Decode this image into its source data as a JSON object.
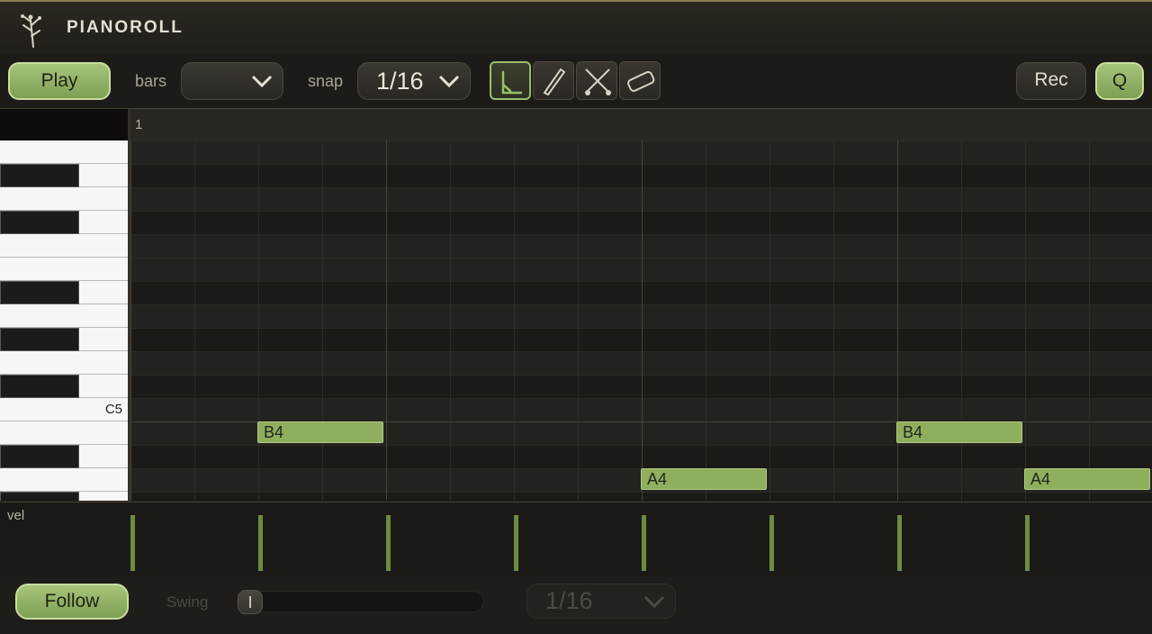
{
  "header": {
    "title": "PIANOROLL",
    "logo_icon": "branch-logo-icon"
  },
  "toolbar": {
    "play_label": "Play",
    "bars_label": "bars",
    "bars_value": "",
    "snap_label": "snap",
    "snap_value": "1/16",
    "tools": [
      "select-tool-icon",
      "pencil-tool-icon",
      "split-tool-icon",
      "eraser-tool-icon"
    ],
    "active_tool": "select-tool-icon",
    "rec_label": "Rec",
    "q_label": "Q"
  },
  "ruler": {
    "bar_number": "1"
  },
  "keyboard": {
    "c5_label": "C5"
  },
  "notes": [
    {
      "label": "B4"
    },
    {
      "label": "A4"
    },
    {
      "label": "B4"
    },
    {
      "label": "A4"
    }
  ],
  "velocity": {
    "label": "vel"
  },
  "footer": {
    "follow_label": "Follow",
    "swing_label": "Swing",
    "swing_value": 0,
    "grid_value": "1/16"
  },
  "colors": {
    "accent": "#9bbd6b",
    "note": "#8fae5e",
    "background": "#1b1916"
  }
}
